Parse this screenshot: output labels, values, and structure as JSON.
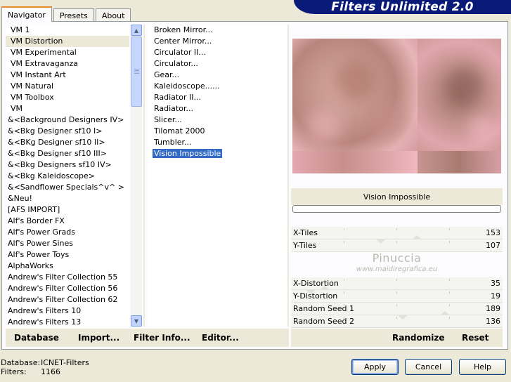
{
  "tabs": [
    "Navigator",
    "Presets",
    "About"
  ],
  "banner_title": "Filters Unlimited 2.0",
  "categories": [
    "VM 1",
    "VM Distortion",
    "VM Experimental",
    "VM Extravaganza",
    "VM Instant Art",
    "VM Natural",
    "VM Toolbox",
    "VM",
    "&<Background Designers IV>",
    "&<Bkg Designer sf10 I>",
    "&<BKg Designer sf10 II>",
    "&<Bkg Designer sf10 III>",
    "&<Bkg Designers sf10 IV>",
    "&<Bkg Kaleidoscope>",
    "&<Sandflower Specials^v^ >",
    "&Neu!",
    "[AFS IMPORT]",
    "Alf's Border FX",
    "Alf's Power Grads",
    "Alf's Power Sines",
    "Alf's Power Toys",
    "AlphaWorks",
    "Andrew's Filter Collection 55",
    "Andrew's Filter Collection 56",
    "Andrew's Filter Collection 62",
    "Andrew's Filters 10",
    "Andrew's Filters 13"
  ],
  "selected_category": "VM Distortion",
  "filters": [
    "Broken Mirror...",
    "Center Mirror...",
    "Circulator II...",
    "Circulator...",
    "Gear...",
    "Kaleidoscope......",
    "Radiator II...",
    "Radiator...",
    "Slicer...",
    "Tilomat 2000",
    "Tumbler...",
    "Vision Impossible"
  ],
  "selected_filter": "Vision Impossible",
  "filter_name": "Vision Impossible",
  "params": [
    {
      "label": "X-Tiles",
      "value": "153",
      "level": 0.6
    },
    {
      "label": "Y-Tiles",
      "value": "107",
      "level": 0.42
    },
    {
      "label": "X-Distortion",
      "value": "35",
      "level": 0.14
    },
    {
      "label": "Y-Distortion",
      "value": "19",
      "level": 0.07
    },
    {
      "label": "Random Seed 1",
      "value": "189",
      "level": 0.74
    },
    {
      "label": "Random Seed 2",
      "value": "136",
      "level": 0.53
    }
  ],
  "watermark": {
    "name": "Pinuccia",
    "url": "www.maidiregrafica.eu"
  },
  "bottom_links": {
    "database": "Database",
    "import": "Import...",
    "filter_info": "Filter Info...",
    "editor": "Editor...",
    "randomize": "Randomize",
    "reset": "Reset"
  },
  "footer": {
    "database_label": "Database:",
    "database_value": "ICNET-Filters",
    "filters_label": "Filters:",
    "filters_value": "1166"
  },
  "buttons": {
    "apply": "Apply",
    "cancel": "Cancel",
    "help": "Help"
  },
  "colors": {
    "banner": "#0a1a78",
    "selection": "#316ac5",
    "tab_highlight": "#e68b2c"
  },
  "icons": {
    "scroll_up": "▲",
    "scroll_down": "▼"
  }
}
